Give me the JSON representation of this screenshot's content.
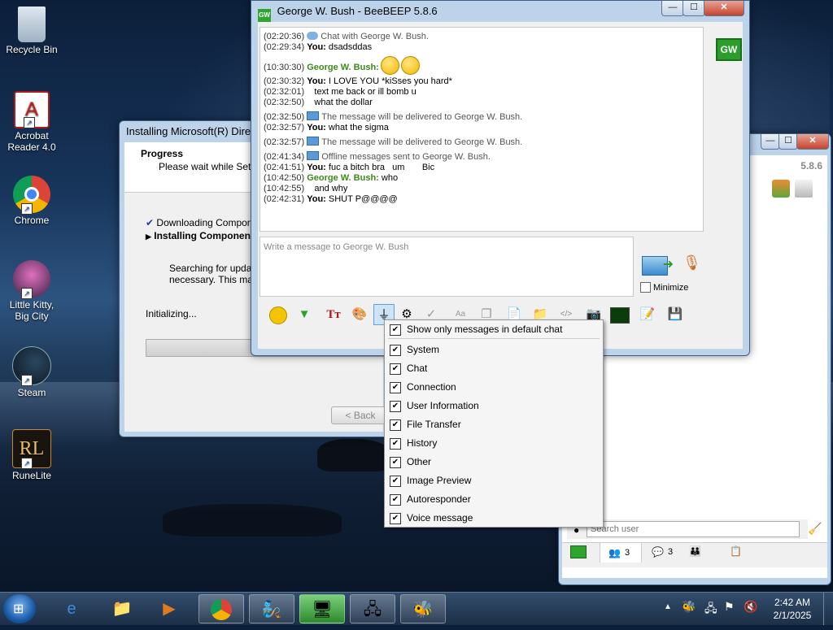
{
  "desktop": {
    "icons": [
      {
        "label": "Recycle Bin",
        "icon": "recycle-bin-icon"
      },
      {
        "label": "Acrobat Reader 4.0",
        "icon": "acrobat-icon"
      },
      {
        "label": "Chrome",
        "icon": "chrome-icon"
      },
      {
        "label": "Little Kitty, Big City",
        "icon": "game-icon"
      },
      {
        "label": "Steam",
        "icon": "steam-icon"
      },
      {
        "label": "RuneLite",
        "icon": "runelite-icon"
      }
    ]
  },
  "installer": {
    "title": "Installing Microsoft(R) Direct",
    "header_title": "Progress",
    "header_sub": "Please wait while Setup",
    "step1": "Downloading Componen",
    "step2": "Installing Componen",
    "search_text": "Searching for update",
    "search_text2": "necessary. This may",
    "status": "Initializing...",
    "back_label": "< Back"
  },
  "chat_window": {
    "title": "George W. Bush - BeeBEEP 5.8.6",
    "badge": "GW",
    "lines": [
      {
        "ts": "(02:20:36)",
        "who": "",
        "text": "Chat with George W. Bush.",
        "kind": "sys-bubble"
      },
      {
        "ts": "(02:29:34)",
        "who": "You:",
        "text": " dsadsddas",
        "kind": "me"
      },
      {
        "ts": "(10:30:30)",
        "who": "George W. Bush:",
        "text": "",
        "kind": "gwb-emoji"
      },
      {
        "ts": "(02:30:32)",
        "who": "You:",
        "text": " I LOVE YOU *kiSses you hard*",
        "kind": "me"
      },
      {
        "ts": "(02:32:01)",
        "who": "",
        "text": "   text me back or ill bomb u",
        "kind": "plain"
      },
      {
        "ts": "(02:32:50)",
        "who": "",
        "text": "   what the dollar",
        "kind": "plain"
      },
      {
        "ts": "(02:32:50)",
        "who": "",
        "text": "The message will be delivered to George W. Bush.",
        "kind": "sys-env"
      },
      {
        "ts": "(02:32:57)",
        "who": "You:",
        "text": " what the sigma",
        "kind": "me"
      },
      {
        "ts": "(02:32:57)",
        "who": "",
        "text": "The message will be delivered to George W. Bush.",
        "kind": "sys-env"
      },
      {
        "ts": "(02:41:34)",
        "who": "",
        "text": "Offline messages sent to George W. Bush.",
        "kind": "sys-env"
      },
      {
        "ts": "(02:41:51)",
        "who": "You:",
        "text": " fuc a bitch bra   um       Bic",
        "kind": "me"
      },
      {
        "ts": "(10:42:50)",
        "who": "George W. Bush:",
        "text": " who",
        "kind": "gwb"
      },
      {
        "ts": "(10:42:55)",
        "who": "",
        "text": "   and why",
        "kind": "plain"
      },
      {
        "ts": "(02:42:31)",
        "who": "You:",
        "text": " SHUT P@@@@",
        "kind": "me"
      }
    ],
    "compose_placeholder": "Write a message to George W. Bush",
    "minimize_label": "Minimize"
  },
  "filter_menu": {
    "items": [
      {
        "label": "Show only messages in default chat",
        "checked": true
      },
      {
        "label": "System",
        "checked": true
      },
      {
        "label": "Chat",
        "checked": true
      },
      {
        "label": "Connection",
        "checked": true
      },
      {
        "label": "User Information",
        "checked": true
      },
      {
        "label": "File Transfer",
        "checked": true
      },
      {
        "label": "History",
        "checked": true
      },
      {
        "label": "Other",
        "checked": true
      },
      {
        "label": "Image Preview",
        "checked": true
      },
      {
        "label": "Autoresponder",
        "checked": true
      },
      {
        "label": "Voice message",
        "checked": true
      }
    ]
  },
  "main_window": {
    "version": "5.8.6",
    "search_placeholder": "Search user",
    "tab_users_count": "3",
    "tab_chats_count": "3"
  },
  "taskbar": {
    "time": "2:42 AM",
    "date": "2/1/2025"
  }
}
